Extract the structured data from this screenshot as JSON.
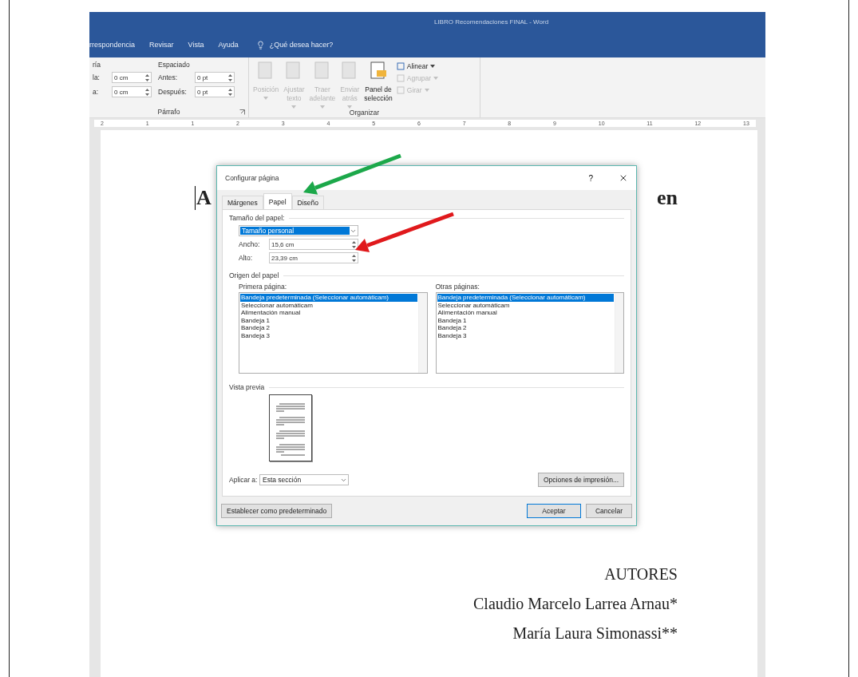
{
  "window": {
    "title": "LIBRO Recomendaciones FINAL  -  Word"
  },
  "ribbon_tabs": [
    {
      "label": "rrespondencia"
    },
    {
      "label": "Revisar"
    },
    {
      "label": "Vista"
    },
    {
      "label": "Ayuda"
    }
  ],
  "tell_me": {
    "placeholder": "¿Qué desea hacer?"
  },
  "indent": {
    "label": "ría",
    "fields": [
      {
        "label": "la:",
        "value": "0 cm"
      },
      {
        "label": "a:",
        "value": "0 cm"
      }
    ]
  },
  "spacing": {
    "label": "Espaciado",
    "fields": [
      {
        "label": "Antes:",
        "value": "0 pt"
      },
      {
        "label": "Después:",
        "value": "0 pt"
      }
    ]
  },
  "paragraph_group": {
    "label": "Párrafo"
  },
  "arrange_group": {
    "label": "Organizar",
    "large_buttons": [
      {
        "lines": [
          "Posición"
        ],
        "dropdown": true,
        "disabled": true
      },
      {
        "lines": [
          "Ajustar",
          "texto"
        ],
        "dropdown": true,
        "disabled": true
      },
      {
        "lines": [
          "Traer",
          "adelante"
        ],
        "dropdown": true,
        "disabled": true
      },
      {
        "lines": [
          "Enviar",
          "atrás"
        ],
        "dropdown": true,
        "disabled": true
      },
      {
        "lines": [
          "Panel de",
          "selección"
        ],
        "dropdown": false,
        "disabled": false
      }
    ],
    "small_buttons": [
      {
        "label": "Alinear",
        "disabled": false
      },
      {
        "label": "Agrupar",
        "disabled": true
      },
      {
        "label": "Girar",
        "disabled": true
      }
    ]
  },
  "ruler": {
    "labels": [
      "2",
      "1",
      "1",
      "2",
      "3",
      "4",
      "5",
      "6",
      "7",
      "8",
      "9",
      "10",
      "11",
      "12",
      "13"
    ]
  },
  "document": {
    "heading_fragments": [
      "A",
      "en"
    ],
    "authors_heading": "AUTORES",
    "authors": [
      "Claudio Marcelo Larrea Arnau*",
      "María Laura Simonassi**"
    ]
  },
  "dialog": {
    "title": "Configurar página",
    "help": "?",
    "tabs": [
      {
        "label": "Márgenes",
        "selected": false
      },
      {
        "label": "Papel",
        "selected": true
      },
      {
        "label": "Diseño",
        "selected": false
      }
    ],
    "paper_size": {
      "label": "Tamaño del papel:",
      "value": "Tamaño personal",
      "width_label": "Ancho:",
      "width": "15,6 cm",
      "height_label": "Alto:",
      "height": "23,39 cm"
    },
    "paper_source": {
      "label": "Origen del papel",
      "lists": [
        {
          "label": "Primera página:",
          "items": [
            {
              "text": "Bandeja predeterminada (Seleccionar automáticam)",
              "selected": true
            },
            {
              "text": "Seleccionar automáticam",
              "selected": false
            },
            {
              "text": "Alimentación manual",
              "selected": false
            },
            {
              "text": "Bandeja 1",
              "selected": false
            },
            {
              "text": "Bandeja 2",
              "selected": false
            },
            {
              "text": "Bandeja 3",
              "selected": false
            }
          ]
        },
        {
          "label": "Otras páginas:",
          "items": [
            {
              "text": "Bandeja predeterminada (Seleccionar automáticam)",
              "selected": true
            },
            {
              "text": "Seleccionar automáticam",
              "selected": false
            },
            {
              "text": "Alimentación manual",
              "selected": false
            },
            {
              "text": "Bandeja 1",
              "selected": false
            },
            {
              "text": "Bandeja 2",
              "selected": false
            },
            {
              "text": "Bandeja 3",
              "selected": false
            }
          ]
        }
      ]
    },
    "preview": {
      "label": "Vista previa"
    },
    "apply_to": {
      "label": "Aplicar a:",
      "value": "Esta sección"
    },
    "print_options": "Opciones de impresión...",
    "set_default": "Establecer como predeterminado",
    "ok": "Aceptar",
    "cancel": "Cancelar"
  },
  "annotations": [
    {
      "kind": "arrow",
      "color": "#1ca84a"
    },
    {
      "kind": "arrow",
      "color": "#e0191c"
    }
  ]
}
